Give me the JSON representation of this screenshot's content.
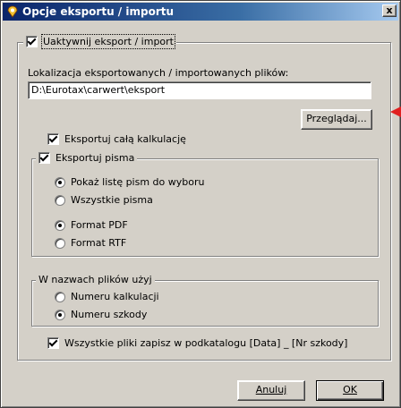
{
  "window": {
    "title": "Opcje eksportu / importu",
    "close_label": "x"
  },
  "activate": {
    "label": "Uaktywnij eksport / import",
    "checked": true
  },
  "location": {
    "label": "Lokalizacja eksportowanych / importowanych plików:",
    "value": "D:\\Eurotax\\carwert\\eksport",
    "browse_label": "Przeglądaj..."
  },
  "export_full": {
    "label": "Eksportuj całą kalkulację",
    "checked": true
  },
  "export_letters": {
    "label": "Eksportuj pisma",
    "checked": true,
    "options_a": [
      {
        "label": "Pokaż listę pism do wyboru",
        "selected": true
      },
      {
        "label": "Wszystkie pisma",
        "selected": false
      }
    ],
    "options_b": [
      {
        "label": "Format PDF",
        "selected": true
      },
      {
        "label": "Format RTF",
        "selected": false
      }
    ]
  },
  "filenames": {
    "label": "W nazwach plików użyj",
    "options": [
      {
        "label": "Numeru kalkulacji",
        "selected": false
      },
      {
        "label": "Numeru szkody",
        "selected": true
      }
    ]
  },
  "subfolder": {
    "label": "Wszystkie pliki zapisz w podkatalogu [Data] _ [Nr szkody]",
    "checked": true
  },
  "buttons": {
    "cancel_label": "Anuluj",
    "ok_label": "OK"
  },
  "colors": {
    "titlebar": "#0a246a",
    "face": "#d4d0c8",
    "arrow": "#e02020"
  }
}
